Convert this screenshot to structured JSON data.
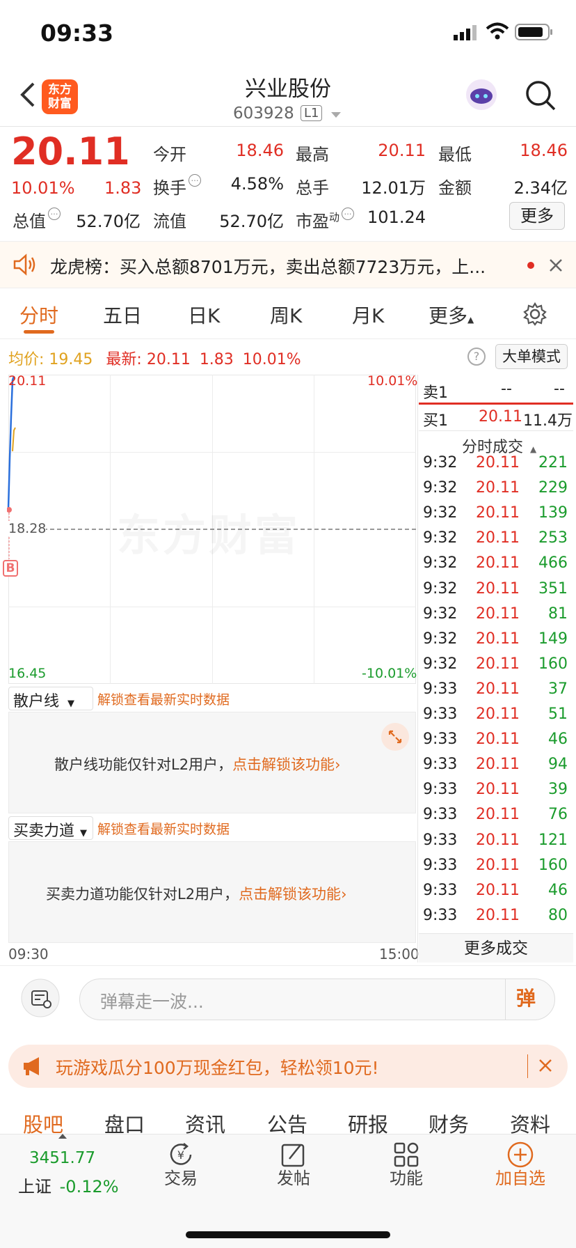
{
  "status_bar": {
    "time": "09:33"
  },
  "header": {
    "logo_line1": "东方",
    "logo_line2": "财富",
    "title": "兴业股份",
    "code": "603928",
    "level": "L1"
  },
  "quote": {
    "price": "20.11",
    "change_pct": "10.01%",
    "change": "1.83",
    "open_label": "今开",
    "open": "18.46",
    "high_label": "最高",
    "high": "20.11",
    "low_label": "最低",
    "low": "18.46",
    "turnover_label": "换手",
    "turnover": "4.58%",
    "volume_label": "总手",
    "volume": "12.01万",
    "amount_label": "金额",
    "amount": "2.34亿",
    "mktcap_label": "总值",
    "mktcap": "52.70亿",
    "float_label": "流值",
    "float": "52.70亿",
    "pe_label": "市盈",
    "pe_sup": "动",
    "pe": "101.24",
    "more": "更多"
  },
  "banner": {
    "text": "龙虎榜：买入总额8701万元，卖出总额7723万元，上..."
  },
  "tabs": [
    "分时",
    "五日",
    "日K",
    "周K",
    "月K",
    "更多"
  ],
  "chart_header": {
    "avg_label": "均价:",
    "avg": "19.45",
    "latest_label": "最新:",
    "latest": "20.11",
    "change": "1.83",
    "change_pct": "10.01%",
    "mode_button": "大单模式"
  },
  "chart": {
    "top_price": "20.11",
    "top_pct": "10.01%",
    "mid_price": "18.28",
    "bottom_price": "16.45",
    "bottom_pct": "-10.01%",
    "time_start": "09:30",
    "time_end": "15:00",
    "watermark": "东方财富",
    "marker": "B"
  },
  "order_book": {
    "sell1_label": "卖1",
    "sell1_price": "--",
    "sell1_vol": "--",
    "buy1_label": "买1",
    "buy1_price": "20.11",
    "buy1_vol": "11.4万"
  },
  "trades": {
    "header": "分时成交",
    "rows": [
      [
        "9:32",
        "20.11",
        "221"
      ],
      [
        "9:32",
        "20.11",
        "229"
      ],
      [
        "9:32",
        "20.11",
        "139"
      ],
      [
        "9:32",
        "20.11",
        "253"
      ],
      [
        "9:32",
        "20.11",
        "466"
      ],
      [
        "9:32",
        "20.11",
        "351"
      ],
      [
        "9:32",
        "20.11",
        "81"
      ],
      [
        "9:32",
        "20.11",
        "149"
      ],
      [
        "9:32",
        "20.11",
        "160"
      ],
      [
        "9:33",
        "20.11",
        "37"
      ],
      [
        "9:33",
        "20.11",
        "51"
      ],
      [
        "9:33",
        "20.11",
        "46"
      ],
      [
        "9:33",
        "20.11",
        "94"
      ],
      [
        "9:33",
        "20.11",
        "39"
      ],
      [
        "9:33",
        "20.11",
        "76"
      ],
      [
        "9:33",
        "20.11",
        "121"
      ],
      [
        "9:33",
        "20.11",
        "160"
      ],
      [
        "9:33",
        "20.11",
        "46"
      ],
      [
        "9:33",
        "20.11",
        "80"
      ]
    ],
    "more": "更多成交"
  },
  "retail_panel": {
    "select": "散户线",
    "unlock": "解锁查看最新实时数据",
    "message": "散户线功能仅针对L2用户，",
    "link": "点击解锁该功能"
  },
  "force_panel": {
    "select": "买卖力道",
    "unlock": "解锁查看最新实时数据",
    "message": "买卖力道功能仅针对L2用户，",
    "link": "点击解锁该功能"
  },
  "comment": {
    "placeholder": "弹幕走一波...",
    "send": "弹"
  },
  "promo": {
    "text": "玩游戏瓜分100万现金红包，轻松领10元!"
  },
  "bottom_tabs": [
    "股吧",
    "盘口",
    "资讯",
    "公告",
    "研报",
    "财务",
    "资料"
  ],
  "footer": {
    "index_value": "3451.77",
    "index_name": "上证",
    "index_change": "-0.12%",
    "trade": "交易",
    "post": "发帖",
    "function": "功能",
    "add": "加自选"
  }
}
